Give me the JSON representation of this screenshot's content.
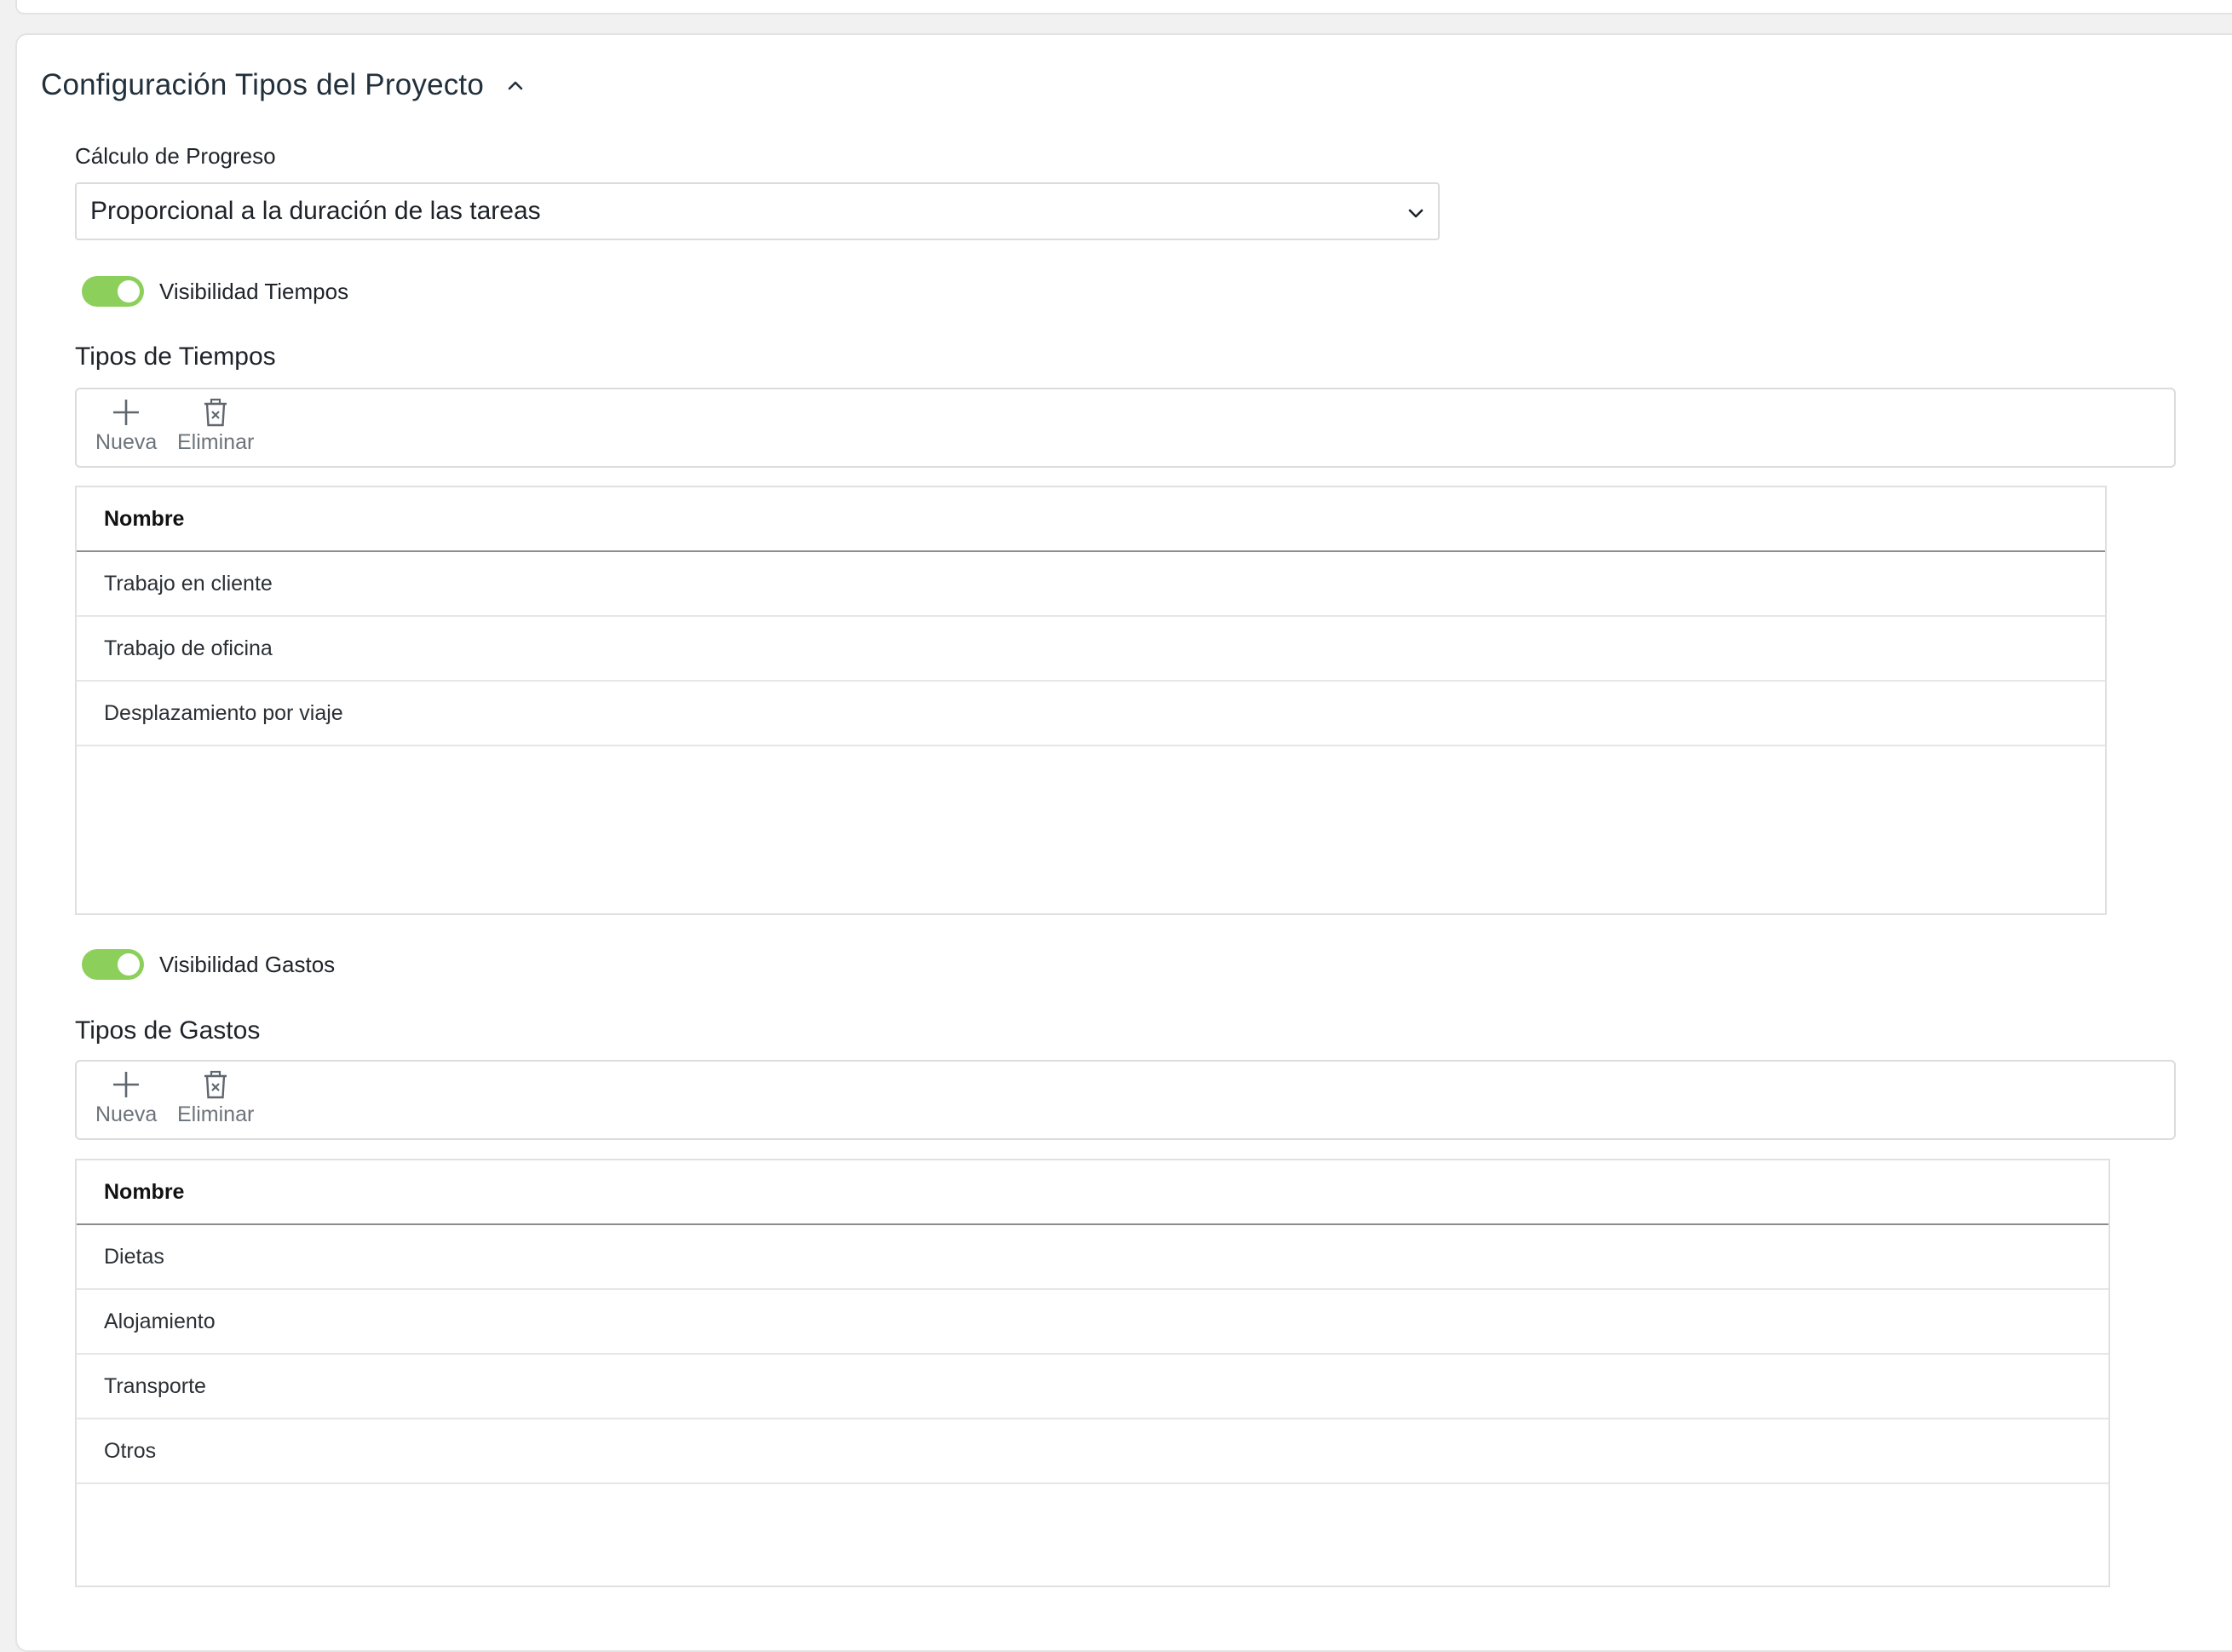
{
  "section": {
    "title": "Configuración Tipos del Proyecto"
  },
  "progress": {
    "label": "Cálculo de Progreso",
    "selected": "Proporcional a la duración de las tareas"
  },
  "times": {
    "toggle_label": "Visibilidad Tiempos",
    "toggle_on": true,
    "heading": "Tipos de Tiempos",
    "toolbar": {
      "new_label": "Nueva",
      "delete_label": "Eliminar"
    },
    "column_header": "Nombre",
    "rows": [
      "Trabajo en cliente",
      "Trabajo de oficina",
      "Desplazamiento por viaje"
    ]
  },
  "expenses": {
    "toggle_label": "Visibilidad Gastos",
    "toggle_on": true,
    "heading": "Tipos de Gastos",
    "toolbar": {
      "new_label": "Nueva",
      "delete_label": "Eliminar"
    },
    "column_header": "Nombre",
    "rows": [
      "Dietas",
      "Alojamiento",
      "Transporte",
      "Otros"
    ]
  },
  "colors": {
    "toggle_on": "#8cd05b",
    "title": "#22303c",
    "toolbar_text": "#6c737a"
  },
  "icons": {
    "collapse": "chevron-up-icon",
    "dropdown": "chevron-down-icon",
    "new": "plus-icon",
    "delete": "trash-icon"
  }
}
